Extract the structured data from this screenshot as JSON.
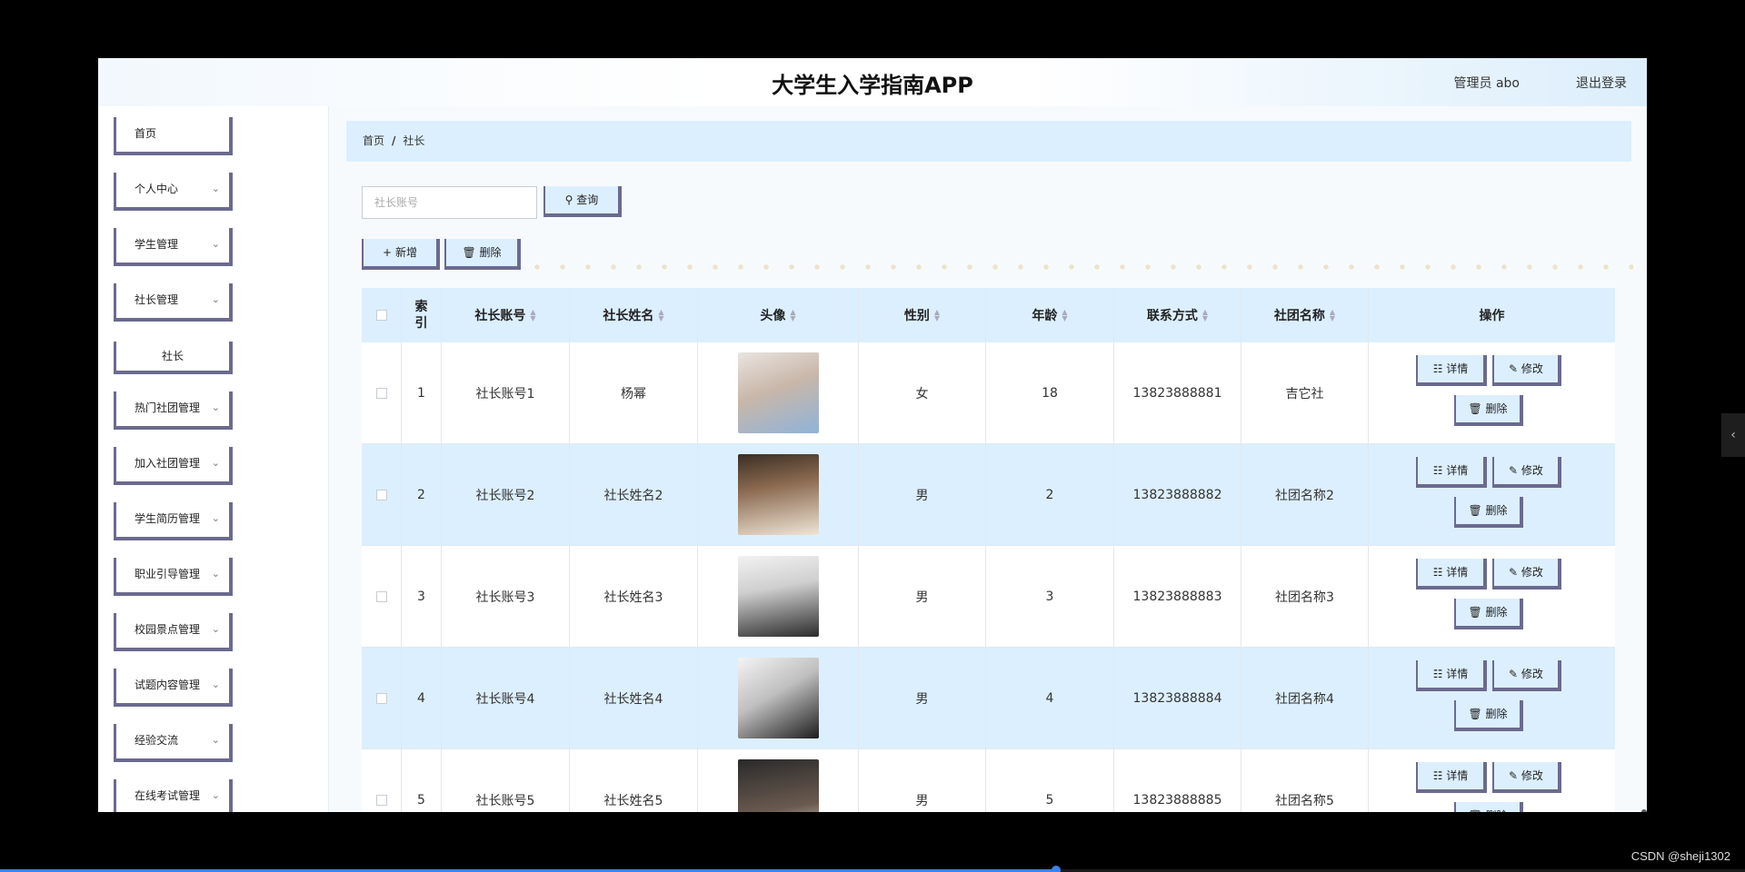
{
  "header": {
    "title": "大学生入学指南APP",
    "user": "管理员 abo",
    "logout": "退出登录"
  },
  "sidebar": {
    "items": [
      {
        "label": "首页",
        "chevron": false
      },
      {
        "label": "个人中心",
        "chevron": true
      },
      {
        "label": "学生管理",
        "chevron": true
      },
      {
        "label": "社长管理",
        "chevron": true
      },
      {
        "label": "社长",
        "chevron": false,
        "sub": true
      },
      {
        "label": "热门社团管理",
        "chevron": true
      },
      {
        "label": "加入社团管理",
        "chevron": true
      },
      {
        "label": "学生简历管理",
        "chevron": true
      },
      {
        "label": "职业引导管理",
        "chevron": true
      },
      {
        "label": "校园景点管理",
        "chevron": true
      },
      {
        "label": "试题内容管理",
        "chevron": true
      },
      {
        "label": "经验交流",
        "chevron": true
      },
      {
        "label": "在线考试管理",
        "chevron": true
      }
    ]
  },
  "breadcrumb": {
    "home": "首页",
    "sep": "/",
    "current": "社长"
  },
  "search": {
    "placeholder": "社长账号",
    "button": "查询"
  },
  "toolbar": {
    "add": "新增",
    "delete": "删除"
  },
  "table": {
    "headers": [
      "索引",
      "社长账号",
      "社长姓名",
      "头像",
      "性别",
      "年龄",
      "联系方式",
      "社团名称",
      "操作"
    ],
    "rows": [
      {
        "index": "1",
        "account": "社长账号1",
        "name": "杨幂",
        "gender": "女",
        "age": "18",
        "phone": "13823888881",
        "club": "吉它社"
      },
      {
        "index": "2",
        "account": "社长账号2",
        "name": "社长姓名2",
        "gender": "男",
        "age": "2",
        "phone": "13823888882",
        "club": "社团名称2"
      },
      {
        "index": "3",
        "account": "社长账号3",
        "name": "社长姓名3",
        "gender": "男",
        "age": "3",
        "phone": "13823888883",
        "club": "社团名称3"
      },
      {
        "index": "4",
        "account": "社长账号4",
        "name": "社长姓名4",
        "gender": "男",
        "age": "4",
        "phone": "13823888884",
        "club": "社团名称4"
      },
      {
        "index": "5",
        "account": "社长账号5",
        "name": "社长姓名5",
        "gender": "男",
        "age": "5",
        "phone": "13823888885",
        "club": "社团名称5"
      }
    ],
    "actions": {
      "detail": "详情",
      "edit": "修改",
      "delete": "删除"
    }
  },
  "player": {
    "progress": 0.605
  },
  "watermark": "CSDN @sheji1302",
  "colors": {
    "accent_bg": "#dcefff",
    "button_border": "#6b6a8f",
    "page_bg": "#000000"
  }
}
